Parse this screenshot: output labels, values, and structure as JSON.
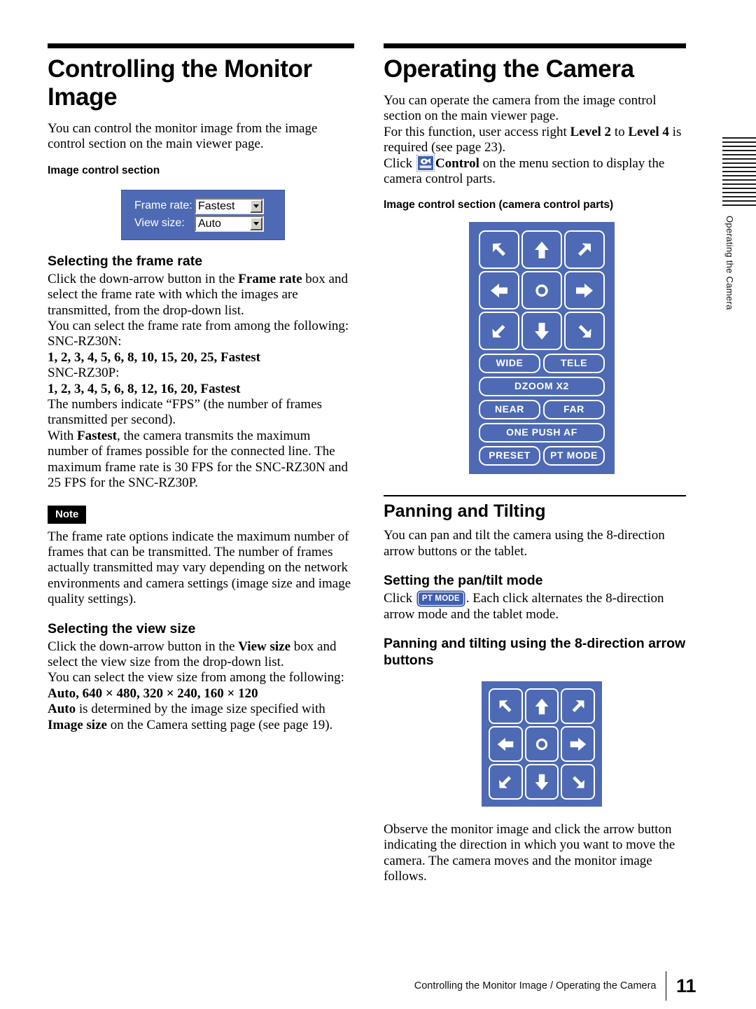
{
  "colors": {
    "panel_blue": "#4e6ab4",
    "button_white": "#ffffff",
    "note_badge_bg": "#000000"
  },
  "left_column": {
    "chapter_title": "Controlling the Monitor Image",
    "intro": "You can control the monitor image from the image control section on the main viewer page.",
    "image_control_heading": "Image control section",
    "image_control_widget": {
      "rows": [
        {
          "label": "Frame rate:",
          "value": "Fastest"
        },
        {
          "label": "View size:",
          "value": "Auto"
        }
      ],
      "arrow_icon": "chevron-down-icon"
    },
    "frame_rate": {
      "heading": "Selecting the frame rate",
      "p1_a": "Click the down-arrow button in the ",
      "p1_b": "Frame rate",
      "p1_c": " box and select the frame rate with which the images are transmitted, from the drop-down list.",
      "p2": "You can select the frame rate from among the following:",
      "model_n_label": "SNC-RZ30N:",
      "model_n_values": "1, 2, 3, 4, 5, 6, 8, 10, 15, 20, 25, Fastest",
      "model_p_label": "SNC-RZ30P:",
      "model_p_values": "1, 2, 3, 4, 5, 6, 8, 12, 16, 20, Fastest",
      "p3": "The numbers indicate “FPS” (the number of frames transmitted per second).",
      "p4_a": "With ",
      "p4_b": "Fastest",
      "p4_c": ", the camera transmits the maximum number of frames possible for the connected line.  The maximum frame rate is 30 FPS for the SNC-RZ30N and 25 FPS for the SNC-RZ30P."
    },
    "note": {
      "badge": "Note",
      "text": "The frame rate options indicate the maximum number of frames that can be transmitted.  The number of frames actually transmitted may vary depending on the network environments and camera settings (image size and image quality settings)."
    },
    "view_size": {
      "heading": "Selecting the view size",
      "p1_a": "Click the down-arrow button in the ",
      "p1_b": "View size",
      "p1_c": " box and select the view size from the drop-down list.",
      "p2": "You can select the view size from among the following:",
      "values": "Auto, 640 × 480, 320 × 240, 160 × 120",
      "p3_a": "Auto",
      "p3_b": " is determined by the image size specified with ",
      "p3_c": "Image size",
      "p3_d": " on the Camera setting page (see page 19)."
    }
  },
  "right_column": {
    "chapter_title": "Operating the Camera",
    "intro1": "You can operate the camera from the image control section on the main viewer page.",
    "intro2_a": "For this function, user access right ",
    "intro2_b": "Level 2",
    "intro2_c": " to ",
    "intro2_d": "Level 4",
    "intro2_e": " is required (see page 23).",
    "click_a": "Click ",
    "click_icon": "control-camera-icon",
    "click_b": "Control",
    "click_c": " on the menu section to display the camera control parts.",
    "camera_parts_heading": "Image control section (camera control parts)",
    "camera_pad": {
      "arrows": [
        {
          "name": "arrow-up-left",
          "glyph": "↖"
        },
        {
          "name": "arrow-up",
          "glyph": "↑"
        },
        {
          "name": "arrow-up-right",
          "glyph": "↗"
        },
        {
          "name": "arrow-left",
          "glyph": "←"
        },
        {
          "name": "home-center",
          "glyph": "○"
        },
        {
          "name": "arrow-right",
          "glyph": "→"
        },
        {
          "name": "arrow-down-left",
          "glyph": "↙"
        },
        {
          "name": "arrow-down",
          "glyph": "↓"
        },
        {
          "name": "arrow-down-right",
          "glyph": "↘"
        }
      ],
      "rows": [
        [
          "WIDE",
          "TELE"
        ],
        [
          "DZOOM X2"
        ],
        [
          "NEAR",
          "FAR"
        ],
        [
          "ONE PUSH AF"
        ],
        [
          "PRESET",
          "PT MODE"
        ]
      ]
    },
    "panning": {
      "heading": "Panning and Tilting",
      "intro": "You can pan and tilt the camera using the 8-direction arrow buttons or the tablet.",
      "mode_heading": "Setting the pan/tilt mode",
      "mode_click": "Click ",
      "mode_button": "PT MODE",
      "mode_rest": ". Each click alternates the 8-direction arrow mode and the tablet mode.",
      "arrow_heading": "Panning and tilting using the 8-direction arrow buttons",
      "observe": "Observe the monitor image and click the arrow button indicating the direction in which you want to move the camera.  The camera moves and the monitor image follows."
    }
  },
  "margin_tab": {
    "label": "Operating the Camera",
    "line_count": 17
  },
  "footer": {
    "text": "Controlling the Monitor Image / Operating the Camera",
    "page_number": "11"
  }
}
